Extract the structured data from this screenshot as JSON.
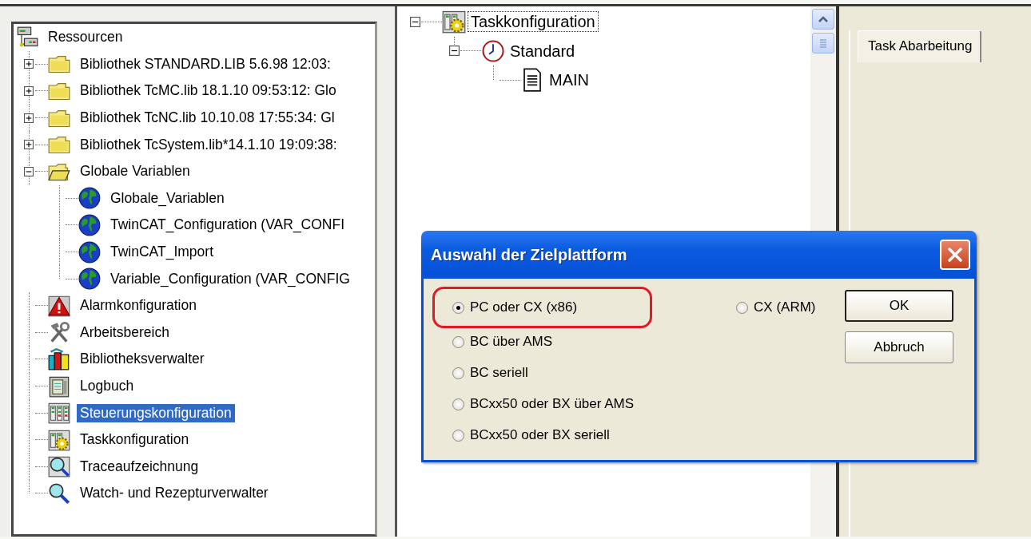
{
  "resources_tree": {
    "label": "Ressourcen",
    "kind": "network",
    "selected": false,
    "children": [
      {
        "label": "Bibliothek STANDARD.LIB 5.6.98 12:03:",
        "kind": "folder",
        "expanded": false,
        "selected": false
      },
      {
        "label": "Bibliothek TcMC.lib 18.1.10 09:53:12: Glo",
        "kind": "folder",
        "expanded": false,
        "selected": false
      },
      {
        "label": "Bibliothek TcNC.lib 10.10.08 17:55:34: Gl",
        "kind": "folder",
        "expanded": false,
        "selected": false
      },
      {
        "label": "Bibliothek TcSystem.lib*14.1.10 19:09:38:",
        "kind": "folder",
        "expanded": false,
        "selected": false
      },
      {
        "label": "Globale Variablen",
        "kind": "openfolder",
        "expanded": true,
        "selected": false,
        "children": [
          {
            "label": "Globale_Variablen",
            "kind": "globe",
            "selected": false
          },
          {
            "label": "TwinCAT_Configuration (VAR_CONFI",
            "kind": "globe",
            "selected": false
          },
          {
            "label": "TwinCAT_Import",
            "kind": "globe",
            "selected": false
          },
          {
            "label": "Variable_Configuration (VAR_CONFIG",
            "kind": "globe",
            "selected": false
          }
        ]
      },
      {
        "label": "Alarmkonfiguration",
        "kind": "alarm",
        "selected": false
      },
      {
        "label": "Arbeitsbereich",
        "kind": "tools",
        "selected": false
      },
      {
        "label": "Bibliotheksverwalter",
        "kind": "books",
        "selected": false
      },
      {
        "label": "Logbuch",
        "kind": "logbook",
        "selected": false
      },
      {
        "label": "Steuerungskonfiguration",
        "kind": "plc",
        "selected": true
      },
      {
        "label": "Taskkonfiguration",
        "kind": "task",
        "selected": false
      },
      {
        "label": "Traceaufzeichnung",
        "kind": "trace",
        "selected": false
      },
      {
        "label": "Watch- und Rezepturverwalter",
        "kind": "magnifier",
        "selected": false
      }
    ]
  },
  "task_tree": {
    "label": "Taskkonfiguration",
    "kind": "task",
    "expanded": true,
    "selected": true,
    "children": [
      {
        "label": "Standard",
        "kind": "clock",
        "expanded": true,
        "selected": false,
        "children": [
          {
            "label": "MAIN",
            "kind": "document",
            "selected": false
          }
        ]
      }
    ]
  },
  "tabs": [
    {
      "label": "Task Abarbeitung",
      "selected": true
    }
  ],
  "dialog": {
    "title": "Auswahl der Zielplattform",
    "columns": [
      [
        {
          "label": "PC oder CX (x86)",
          "selected": true,
          "highlighted": true
        },
        {
          "label": "BC über AMS",
          "selected": false,
          "highlighted": false
        },
        {
          "label": "BC seriell",
          "selected": false,
          "highlighted": false
        },
        {
          "label": "BCxx50 oder BX über AMS",
          "selected": false,
          "highlighted": false
        },
        {
          "label": "BCxx50 oder BX seriell",
          "selected": false,
          "highlighted": false
        }
      ],
      [
        {
          "label": "CX (ARM)",
          "selected": false,
          "highlighted": false
        }
      ]
    ],
    "buttons": [
      {
        "label": "OK",
        "default": true
      },
      {
        "label": "Abbruch",
        "default": false
      }
    ]
  }
}
